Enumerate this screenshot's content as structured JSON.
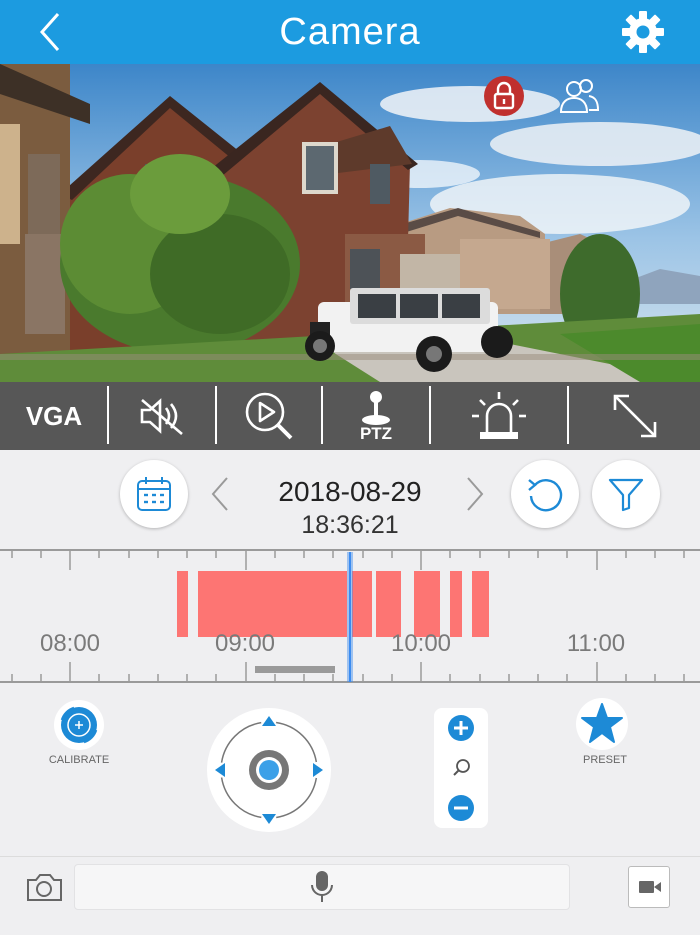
{
  "header": {
    "title": "Camera",
    "back_icon": "chevron-left-icon",
    "settings_icon": "gear-icon",
    "bg_color": "#1c9be0"
  },
  "video": {
    "overlay_icons": [
      "lock-icon",
      "users-icon"
    ]
  },
  "toolbar": {
    "resolution_label": "VGA",
    "ptz_label": "PTZ",
    "icons": [
      "mute-icon",
      "playback-search-icon",
      "ptz-joystick-icon",
      "alarm-siren-icon",
      "fullscreen-icon"
    ]
  },
  "playback": {
    "date": "2018-08-29",
    "time": "18:36:21",
    "icons": [
      "calendar-icon",
      "prev-day-icon",
      "next-day-icon",
      "refresh-icon",
      "filter-icon"
    ]
  },
  "timeline": {
    "tick_labels": [
      "08:00",
      "09:00",
      "10:00",
      "11:00"
    ],
    "recording_color": "#fd7573",
    "cursor_color": "#3b8bf0"
  },
  "controls": {
    "calibrate_label": "CALIBRATE",
    "preset_label": "PRESET",
    "accent_color": "#1d8ad6"
  },
  "bottom": {
    "icons": [
      "camera-snapshot-icon",
      "microphone-icon",
      "record-video-icon"
    ]
  }
}
